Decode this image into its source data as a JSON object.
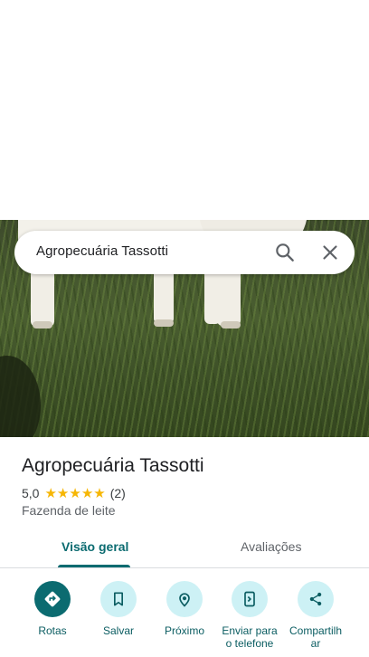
{
  "search": {
    "query": "Agropecuária Tassotti"
  },
  "icons": {
    "search": "search-icon",
    "close": "close-icon",
    "directions": "directions-icon",
    "save": "bookmark-icon",
    "nearby": "nearby-icon",
    "send": "send-to-phone-icon",
    "share": "share-icon"
  },
  "place": {
    "title": "Agropecuária Tassotti",
    "rating": "5,0",
    "stars": 5,
    "reviews_count": "(2)",
    "category": "Fazenda de leite"
  },
  "tabs": [
    {
      "label": "Visão geral",
      "active": true
    },
    {
      "label": "Avaliações",
      "active": false
    }
  ],
  "actions": [
    {
      "label": "Rotas"
    },
    {
      "label": "Salvar"
    },
    {
      "label": "Próximo"
    },
    {
      "label": "Enviar para o telefone"
    },
    {
      "label": "Compartilhar"
    }
  ],
  "colors": {
    "accent": "#0b6b70",
    "accent_light": "#cdf1f5",
    "star": "#f6b604"
  }
}
